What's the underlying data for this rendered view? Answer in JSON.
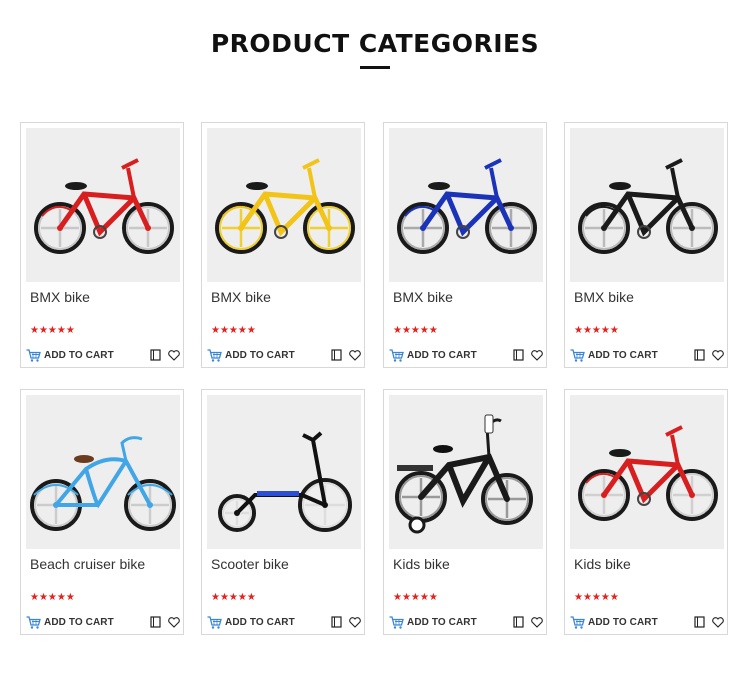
{
  "section": {
    "title": "PRODUCT CATEGORIES"
  },
  "colors": {
    "accent": "#e8201d",
    "cart_icon": "#3a86d6",
    "image_bg": "#eeeeee"
  },
  "products": [
    {
      "name": "BMX bike",
      "rating": 5,
      "stars": "★★★★★",
      "cart_label": "ADD TO CART",
      "image": "red-bmx-bike",
      "frame": "#d81e1e",
      "wheel": "#c8c8c8",
      "style": "bmx"
    },
    {
      "name": "BMX bike",
      "rating": 5,
      "stars": "★★★★★",
      "cart_label": "ADD TO CART",
      "image": "yellow-bmx-bike",
      "frame": "#f2c418",
      "wheel": "#f0d030",
      "style": "bmx"
    },
    {
      "name": "BMX bike",
      "rating": 5,
      "stars": "★★★★★",
      "cart_label": "ADD TO CART",
      "image": "blue-bmx-bike",
      "frame": "#1b33b8",
      "wheel": "#aaaaaa",
      "style": "bmx"
    },
    {
      "name": "BMX bike",
      "rating": 5,
      "stars": "★★★★★",
      "cart_label": "ADD TO CART",
      "image": "black-bmx-bike",
      "frame": "#1a1a1a",
      "wheel": "#bbbbbb",
      "style": "bmx"
    },
    {
      "name": "Beach cruiser bike",
      "rating": 5,
      "stars": "★★★★★",
      "cart_label": "ADD TO CART",
      "image": "blue-cruiser-bike",
      "frame": "#41a6e6",
      "wheel": "#cccccc",
      "style": "cruiser"
    },
    {
      "name": "Scooter bike",
      "rating": 5,
      "stars": "★★★★★",
      "cart_label": "ADD TO CART",
      "image": "black-scooter-bike",
      "frame": "#111111",
      "wheel": "#dddddd",
      "style": "scooter"
    },
    {
      "name": "Kids bike",
      "rating": 5,
      "stars": "★★★★★",
      "cart_label": "ADD TO CART",
      "image": "black-kids-bike",
      "frame": "#1a1a1a",
      "wheel": "#999999",
      "style": "kids"
    },
    {
      "name": "Kids bike",
      "rating": 5,
      "stars": "★★★★★",
      "cart_label": "ADD TO CART",
      "image": "red-kids-bike",
      "frame": "#d81e1e",
      "wheel": "#d0d0d0",
      "style": "bmx"
    }
  ]
}
